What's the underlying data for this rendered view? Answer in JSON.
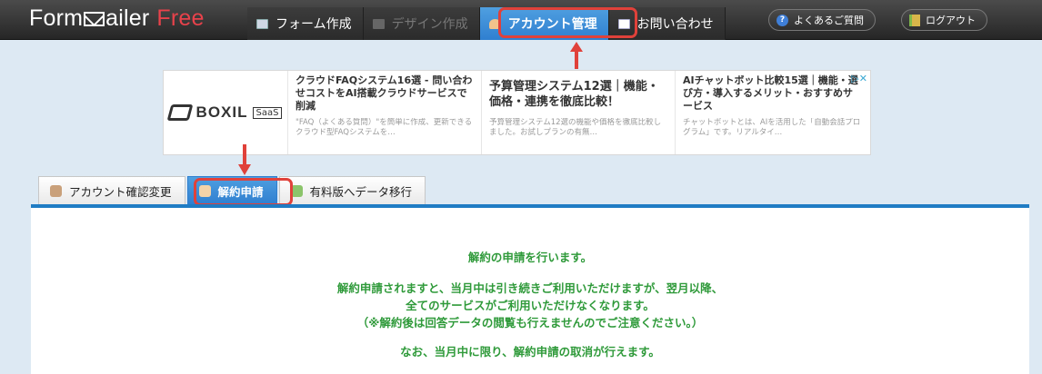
{
  "header": {
    "logo_main": "Form",
    "logo_mid": "ailer",
    "logo_free": "Free",
    "tabs": [
      {
        "label": "フォーム作成",
        "icon": "form-icon",
        "state": "normal"
      },
      {
        "label": "デザイン作成",
        "icon": "design-icon",
        "state": "disabled"
      },
      {
        "label": "アカウント管理",
        "icon": "account-icon",
        "state": "active"
      },
      {
        "label": "お問い合わせ",
        "icon": "mail-icon",
        "state": "normal"
      }
    ],
    "faq_label": "よくあるご質問",
    "logout_label": "ログアウト"
  },
  "ad": {
    "brand": "BOXIL",
    "brand_badge": "SaaS",
    "items": [
      {
        "title": "クラウドFAQシステム16選 - 問い合わせコストをAI搭載クラウドサービスで削減",
        "desc": "\"FAQ（よくある質問）\"を簡単に作成、更新できるクラウド型FAQシステムを…"
      },
      {
        "title": "予算管理システム12選｜機能・価格・連携を徹底比較！",
        "desc": "予算管理システム12選の機能や価格を徹底比較しました。お試しプランの有無…"
      },
      {
        "title": "AIチャットボット比較15選｜機能・選び方・導入するメリット・おすすめサービス",
        "desc": "チャットボットとは、AIを活用した「自動会話プログラム」です。リアルタイ…"
      }
    ]
  },
  "subtabs": [
    {
      "label": "アカウント確認変更",
      "state": "normal"
    },
    {
      "label": "解約申請",
      "state": "active"
    },
    {
      "label": "有料版へデータ移行",
      "state": "normal"
    }
  ],
  "content": {
    "line1": "解約の申請を行います。",
    "line2": "解約申請されますと、当月中は引き続きご利用いただけますが、翌月以降、",
    "line3": "全てのサービスがご利用いただけなくなります。",
    "line4": "（※解約後は回答データの閲覧も行えませんのでご注意ください。）",
    "line5": "なお、当月中に限り、解約申請の取消が行えます。"
  },
  "colors": {
    "accent_blue": "#2f7fd0",
    "highlight_red": "#e0413a",
    "message_green": "#2f9a3a"
  }
}
